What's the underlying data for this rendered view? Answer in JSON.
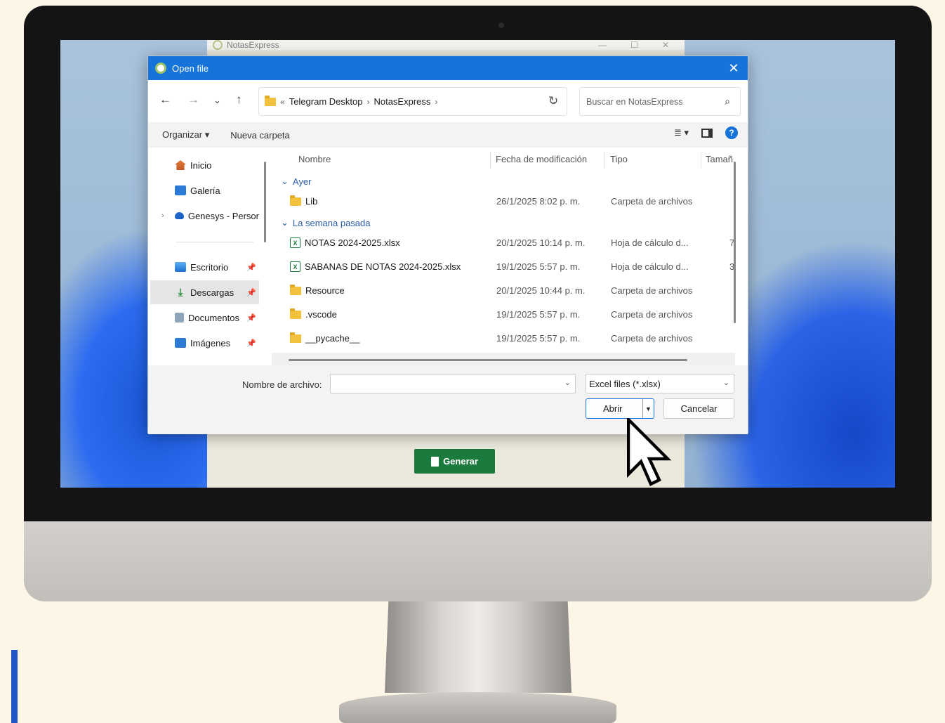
{
  "background_app": {
    "title": "NotasExpress",
    "generate_button": "Generar"
  },
  "dialog": {
    "title": "Open file",
    "breadcrumb": {
      "overflow": "«",
      "items": [
        "Telegram Desktop",
        "NotasExpress"
      ]
    },
    "search_placeholder": "Buscar en NotasExpress",
    "toolbar": {
      "organize": "Organizar",
      "new_folder": "Nueva carpeta"
    },
    "sidebar": {
      "items": [
        {
          "label": "Inicio",
          "icon": "home-icon"
        },
        {
          "label": "Galería",
          "icon": "gallery-icon"
        },
        {
          "label": "Genesys - Persor",
          "icon": "cloud-icon"
        },
        {
          "label": "Escritorio",
          "icon": "desktop-icon"
        },
        {
          "label": "Descargas",
          "icon": "download-icon"
        },
        {
          "label": "Documentos",
          "icon": "documents-icon"
        },
        {
          "label": "Imágenes",
          "icon": "images-icon"
        }
      ]
    },
    "columns": {
      "name": "Nombre",
      "date": "Fecha de modificación",
      "type": "Tipo",
      "size": "Tamañ"
    },
    "groups": [
      {
        "label": "Ayer",
        "rows": [
          {
            "name": "Lib",
            "date": "26/1/2025 8:02 p. m.",
            "type": "Carpeta de archivos",
            "size": "",
            "icon": "folder-icon"
          }
        ]
      },
      {
        "label": "La semana pasada",
        "rows": [
          {
            "name": "NOTAS 2024-2025.xlsx",
            "date": "20/1/2025 10:14 p. m.",
            "type": "Hoja de cálculo d...",
            "size": "7",
            "icon": "excel-icon"
          },
          {
            "name": "SABANAS DE NOTAS 2024-2025.xlsx",
            "date": "19/1/2025 5:57 p. m.",
            "type": "Hoja de cálculo d...",
            "size": "3",
            "icon": "excel-icon"
          },
          {
            "name": "Resource",
            "date": "20/1/2025 10:44 p. m.",
            "type": "Carpeta de archivos",
            "size": "",
            "icon": "folder-icon"
          },
          {
            "name": ".vscode",
            "date": "19/1/2025 5:57 p. m.",
            "type": "Carpeta de archivos",
            "size": "",
            "icon": "folder-icon"
          },
          {
            "name": "__pycache__",
            "date": "19/1/2025 5:57 p. m.",
            "type": "Carpeta de archivos",
            "size": "",
            "icon": "folder-icon"
          }
        ]
      }
    ],
    "filename_label": "Nombre de archivo:",
    "filename_value": "",
    "filetype_value": "Excel files (*.xlsx)",
    "open_button": "Abrir",
    "cancel_button": "Cancelar"
  },
  "colors": {
    "accent": "#1573d9",
    "generate": "#1b7a3e",
    "page_background": "#fdf5e6"
  }
}
